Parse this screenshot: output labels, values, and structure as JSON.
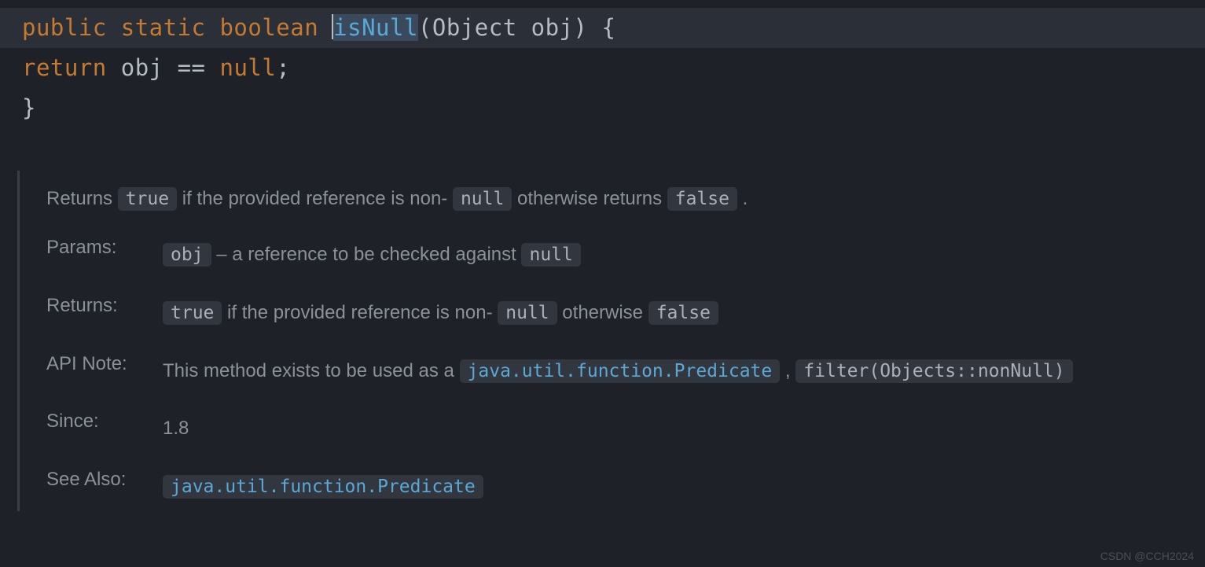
{
  "code": {
    "kw_public": "public",
    "kw_static": "static",
    "kw_boolean": "boolean",
    "fn_name": "isNull",
    "param_type": "Object",
    "param_name": "obj",
    "kw_return": "return",
    "var": "obj",
    "op": "==",
    "kw_null": "null"
  },
  "doc": {
    "summary_pre": "Returns ",
    "summary_true": "true",
    "summary_mid": " if the provided reference is non- ",
    "summary_null": "null",
    "summary_mid2": " otherwise returns ",
    "summary_false": "false",
    "summary_end": " .",
    "params_label": "Params:",
    "params_obj": "obj",
    "params_desc_pre": " – a reference to be checked against ",
    "params_null": "null",
    "returns_label": "Returns:",
    "returns_true": "true",
    "returns_mid": " if the provided reference is non- ",
    "returns_null": "null",
    "returns_mid2": " otherwise ",
    "returns_false": "false",
    "apinote_label": "API Note:",
    "apinote_pre": "This method exists to be used as a ",
    "apinote_predicate": "java.util.function.Predicate",
    "apinote_sep": " , ",
    "apinote_filter": "filter(Objects::nonNull)",
    "since_label": "Since:",
    "since_value": "1.8",
    "seealso_label": "See Also:",
    "seealso_link": "java.util.function.Predicate"
  },
  "watermark": "CSDN @CCH2024"
}
